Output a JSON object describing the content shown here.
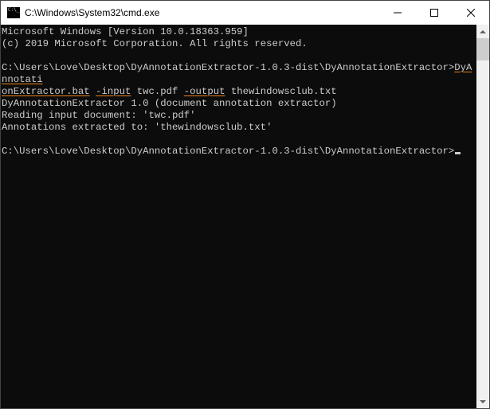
{
  "title": "C:\\Windows\\System32\\cmd.exe",
  "banner_line1": "Microsoft Windows [Version 10.0.18363.959]",
  "banner_line2": "(c) 2019 Microsoft Corporation. All rights reserved.",
  "prompt1_path": "C:\\Users\\Love\\Desktop\\DyAnnotationExtractor-1.0.3-dist\\DyAnnotationExtractor>",
  "cmd1_part1": "DyAnnotati",
  "cmd1_part2": "onExtractor.bat",
  "cmd1_space1": " ",
  "cmd1_flag_input": "-input",
  "cmd1_arg_input": " twc.pdf ",
  "cmd1_flag_output": "-output",
  "cmd1_arg_output": " thewindowsclub.txt",
  "output_line1": "DyAnnotationExtractor 1.0 (document annotation extractor)",
  "output_line2": "Reading input document: 'twc.pdf'",
  "output_line3": "Annotations extracted to: 'thewindowsclub.txt'",
  "prompt2_path": "C:\\Users\\Love\\Desktop\\DyAnnotationExtractor-1.0.3-dist\\DyAnnotationExtractor>"
}
